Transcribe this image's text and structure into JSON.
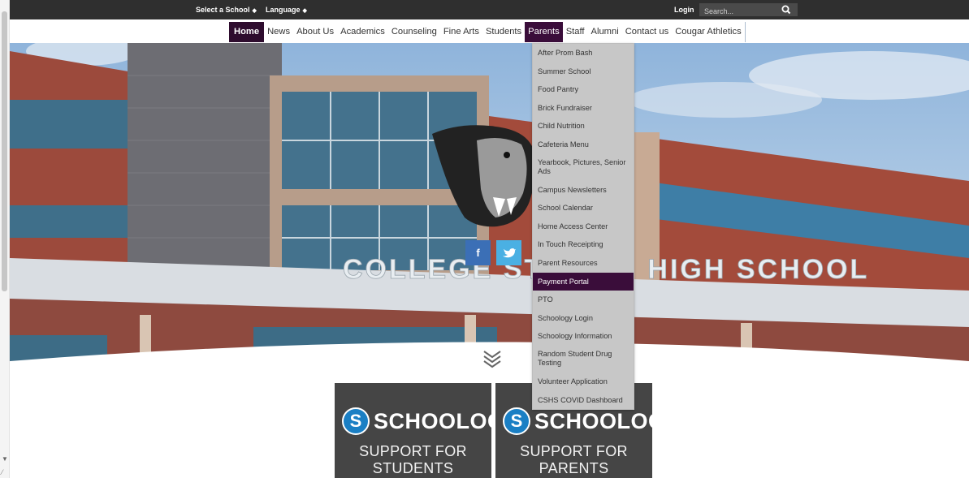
{
  "utility_bar": {
    "school_select": "Select a School",
    "language": "Language",
    "login": "Login",
    "search_placeholder": "Search..."
  },
  "nav": {
    "items": [
      "Home",
      "News",
      "About Us",
      "Academics",
      "Counseling",
      "Fine Arts",
      "Students",
      "Parents",
      "Staff",
      "Alumni",
      "Contact us",
      "Cougar Athletics"
    ]
  },
  "hero": {
    "building_sign": "COLLEGE STATION HIGH SCHOOL"
  },
  "parents_menu": {
    "items": [
      "After Prom Bash",
      "Summer School",
      "Food Pantry",
      "Brick Fundraiser",
      "Child Nutrition",
      "Cafeteria Menu",
      "Yearbook, Pictures, Senior Ads",
      "Campus Newsletters",
      "School Calendar",
      "Home Access Center",
      "In Touch Receipting",
      "Parent Resources",
      "Payment Portal",
      "PTO",
      "Schoology Login",
      "Schoology Information",
      "Random Student Drug Testing",
      "Volunteer Application",
      "CSHS COVID Dashboard"
    ]
  },
  "cards": [
    {
      "logo_letter": "S",
      "brand": "SCHOOLOGY",
      "subtitle": "SUPPORT FOR STUDENTS"
    },
    {
      "logo_letter": "S",
      "brand": "SCHOOLOGY",
      "subtitle": "SUPPORT FOR PARENTS"
    }
  ],
  "social": {
    "facebook": "f",
    "twitter": "t"
  },
  "colors": {
    "accent": "#3a0d3a",
    "topbar": "#2f2f2f",
    "dropdown": "#c7c7c7",
    "facebook": "#3b6fb6",
    "twitter": "#4ab0e3"
  }
}
